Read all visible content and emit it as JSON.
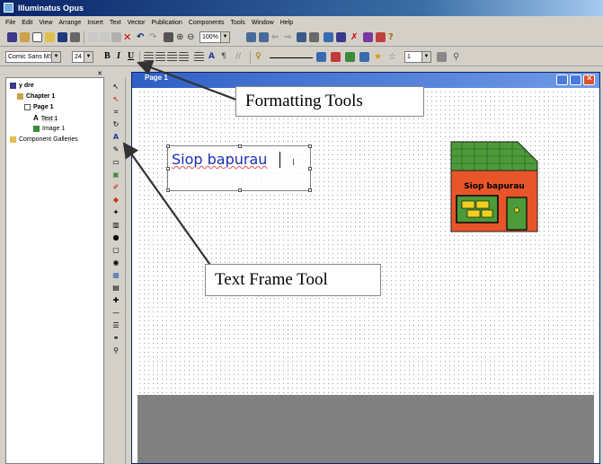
{
  "window": {
    "title": "Illuminatus Opus"
  },
  "menu": [
    "File",
    "Edit",
    "View",
    "Arrange",
    "Insert",
    "Text",
    "Vector",
    "Publication",
    "Components",
    "Tools",
    "Window",
    "Help"
  ],
  "toolbar": {
    "zoom_value": "100%",
    "font_name": "Comic Sans MS",
    "font_size": "24",
    "line_value": "1",
    "bold_label": "B",
    "italic_label": "I",
    "underline_label": "U"
  },
  "project_tree": {
    "root": "y dre",
    "chapter": "Chapter 1",
    "page": "Page 1",
    "text_item": "Text 1",
    "image_item": "Image 1",
    "galleries": "Component Galleries"
  },
  "document": {
    "title": "Page 1",
    "text_frame_content": "Siop bapurau",
    "shop_sign": "Siop bapurau"
  },
  "callouts": {
    "formatting": "Formatting Tools",
    "text_frame": "Text Frame Tool"
  },
  "colors": {
    "title_bar": "#0a246a",
    "frame_text": "#1a2eb0",
    "shop_wall": "#e8552a",
    "shop_roof": "#4c9a3a"
  }
}
